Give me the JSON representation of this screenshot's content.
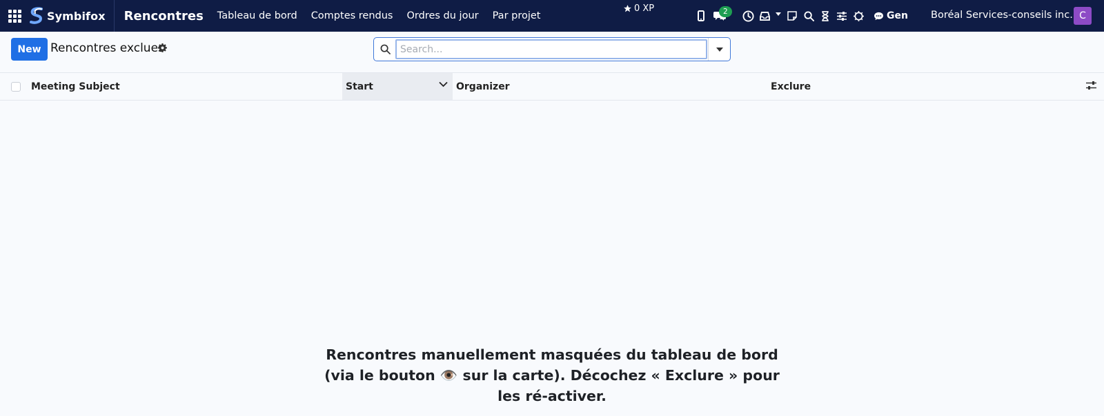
{
  "navbar": {
    "brand_name": "Symbifox",
    "app_name": "Rencontres",
    "menu": [
      {
        "label": "Tableau de bord"
      },
      {
        "label": "Comptes rendus"
      },
      {
        "label": "Ordres du jour"
      },
      {
        "label": "Par projet"
      }
    ],
    "xp_label": "0 XP",
    "messages_count": "2",
    "gen_label": "Gen",
    "company": "Boréal Services-conseils inc.",
    "avatar_initial": "C"
  },
  "control": {
    "new_label": "New",
    "title": "Rencontres exclues",
    "search_placeholder": "Search..."
  },
  "table": {
    "columns": [
      "Meeting Subject",
      "Start",
      "Organizer",
      "Exclure"
    ]
  },
  "helper_text": "Rencontres manuellement masquées du tableau de bord (via le bouton 👁️ sur la carte). Décochez « Exclure » pour les ré-activer.",
  "colors": {
    "navbar": "#0f1c45",
    "primary": "#1f6fe5",
    "badge": "#1e9e52",
    "avatar": "#8d4bc6"
  }
}
